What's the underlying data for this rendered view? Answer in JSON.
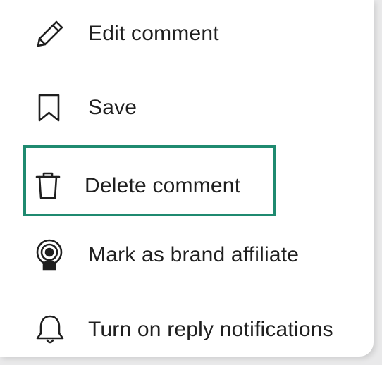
{
  "menu": {
    "items": [
      {
        "label": "Edit comment",
        "icon": "pencil-icon"
      },
      {
        "label": "Save",
        "icon": "bookmark-icon"
      },
      {
        "label": "Delete comment",
        "icon": "trash-icon"
      },
      {
        "label": "Mark as brand affiliate",
        "icon": "brand-affiliate-icon"
      },
      {
        "label": "Turn on reply notifications",
        "icon": "bell-icon"
      }
    ],
    "highlighted_item": "Delete comment"
  },
  "colors": {
    "background": "#e9e9ea",
    "menu_background": "#ffffff",
    "text": "#1f1f1f",
    "icon_stroke": "#1f1f1f",
    "highlight_border": "#1f8a70"
  }
}
